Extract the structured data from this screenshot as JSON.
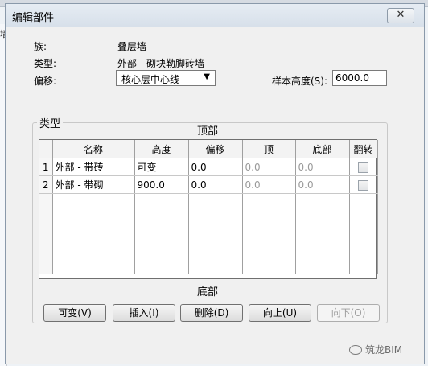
{
  "background": {
    "left_label": "墙"
  },
  "dialog": {
    "title": "编辑部件",
    "close_label": "✕",
    "family_label": "族:",
    "family_value": "叠层墙",
    "type_label": "类型:",
    "type_value": "外部 - 砌块勒脚砖墙",
    "offset_label": "偏移:",
    "offset_value": "核心层中心线",
    "sample_height_label": "样本高度(S):",
    "sample_height_value": "6000.0",
    "types_group_label": "类型",
    "top_label": "顶部",
    "bottom_label": "底部",
    "columns": [
      "名称",
      "高度",
      "偏移",
      "顶",
      "底部",
      "翻转"
    ],
    "rows": [
      {
        "index": "1",
        "name": "外部 - 带砖",
        "height": "可变",
        "offset": "0.0",
        "top": "0.0",
        "bottom": "0.0"
      },
      {
        "index": "2",
        "name": "外部 - 带砌",
        "height": "900.0",
        "offset": "0.0",
        "top": "0.0",
        "bottom": "0.0"
      }
    ],
    "buttons": {
      "variable": "可变(V)",
      "insert": "插入(I)",
      "delete": "删除(D)",
      "up": "向上(U)",
      "down": "向下(O)"
    }
  },
  "watermark": "筑龙BIM"
}
